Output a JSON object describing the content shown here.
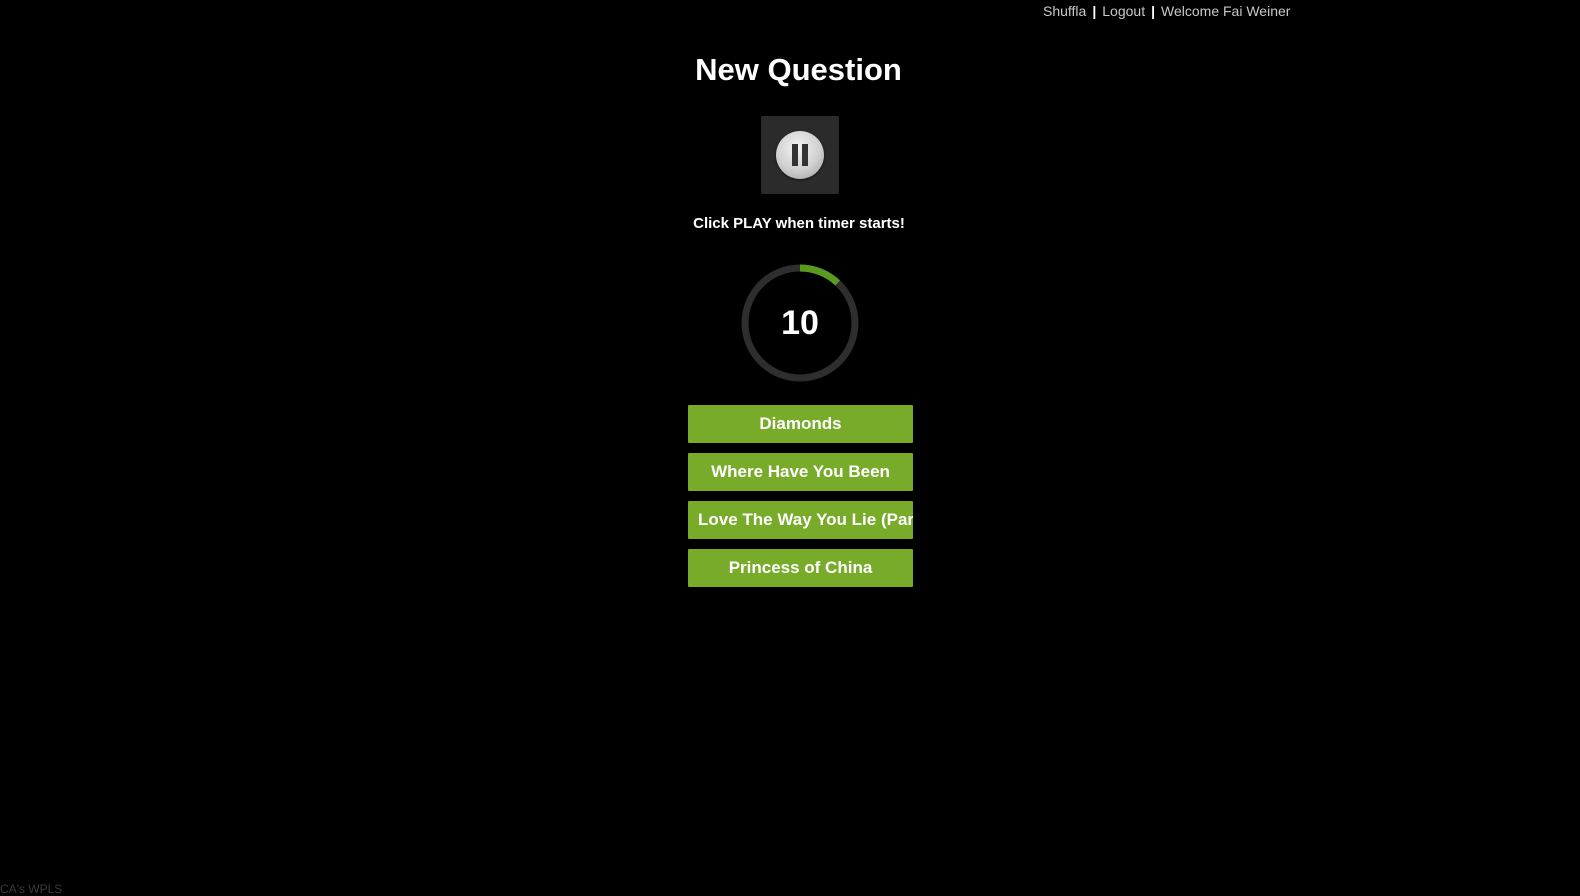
{
  "top_nav": {
    "brand": "Shuffla",
    "logout": "Logout",
    "welcome": "Welcome Fai Weiner"
  },
  "page_title": "New Question",
  "player": {
    "state": "playing",
    "control_icon": "pause-icon"
  },
  "instruction": "Click PLAY when timer starts!",
  "timer": {
    "value": "10",
    "progress_fraction": 0.12,
    "track_color": "#2e2e2e",
    "progress_color": "#5a9a1e"
  },
  "answers": [
    {
      "label": "Diamonds"
    },
    {
      "label": "Where Have You Been"
    },
    {
      "label": "Love The Way You Lie (Part II)"
    },
    {
      "label": "Princess of China"
    }
  ],
  "colors": {
    "background": "#000000",
    "answer_button": "#78ab2a"
  },
  "footer": "CA's WPLS"
}
